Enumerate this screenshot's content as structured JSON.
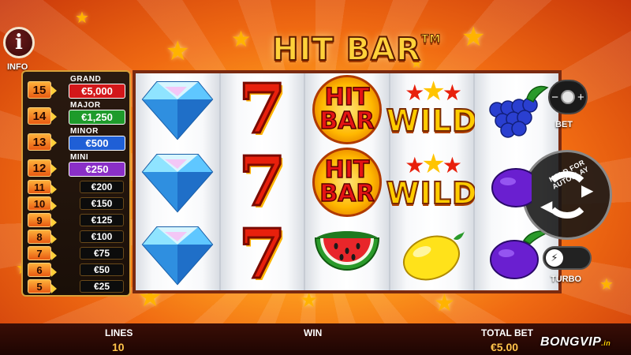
{
  "game": {
    "title": "HIT BAR",
    "trademark": "TM"
  },
  "info": {
    "icon": "info-icon",
    "label": "INFO"
  },
  "jackpots": [
    {
      "number": "15",
      "name": "GRAND",
      "value": "€5,000",
      "color": "#d3171a"
    },
    {
      "number": "14",
      "name": "MAJOR",
      "value": "€1,250",
      "color": "#1e9b2b"
    },
    {
      "number": "13",
      "name": "MINOR",
      "value": "€500",
      "color": "#1f5fd6"
    },
    {
      "number": "12",
      "name": "MINI",
      "value": "€250",
      "color": "#8a2fc7"
    }
  ],
  "paytable": [
    {
      "number": "11",
      "value": "€200"
    },
    {
      "number": "10",
      "value": "€150"
    },
    {
      "number": "9",
      "value": "€125"
    },
    {
      "number": "8",
      "value": "€100"
    },
    {
      "number": "7",
      "value": "€75"
    },
    {
      "number": "6",
      "value": "€50"
    },
    {
      "number": "5",
      "value": "€25"
    }
  ],
  "reels": [
    [
      "diamond",
      "diamond",
      "diamond"
    ],
    [
      "seven",
      "seven",
      "seven"
    ],
    [
      "hit-bar",
      "hit-bar",
      "watermelon"
    ],
    [
      "wild",
      "wild",
      "lemon"
    ],
    [
      "grapes",
      "plum",
      "plum"
    ]
  ],
  "symbol_text": {
    "hit": "HIT",
    "bar": "BAR",
    "wild": "WILD",
    "seven": "7"
  },
  "controls": {
    "bet_label": "BET",
    "bet_icons": "−  +",
    "autoplay_hint": "HOLD FOR AUTOPLAY",
    "spin_icon": "spin-icon",
    "turbo_label": "TURBO",
    "turbo_icon": "lightning-icon"
  },
  "bottom_bar": {
    "lines_label": "LINES",
    "lines_value": "10",
    "win_label": "WIN",
    "total_bet_label": "TOTAL BET",
    "total_bet_value": "€5.00"
  },
  "watermark": {
    "brand": "BONGVIP",
    "suffix": ".in"
  }
}
